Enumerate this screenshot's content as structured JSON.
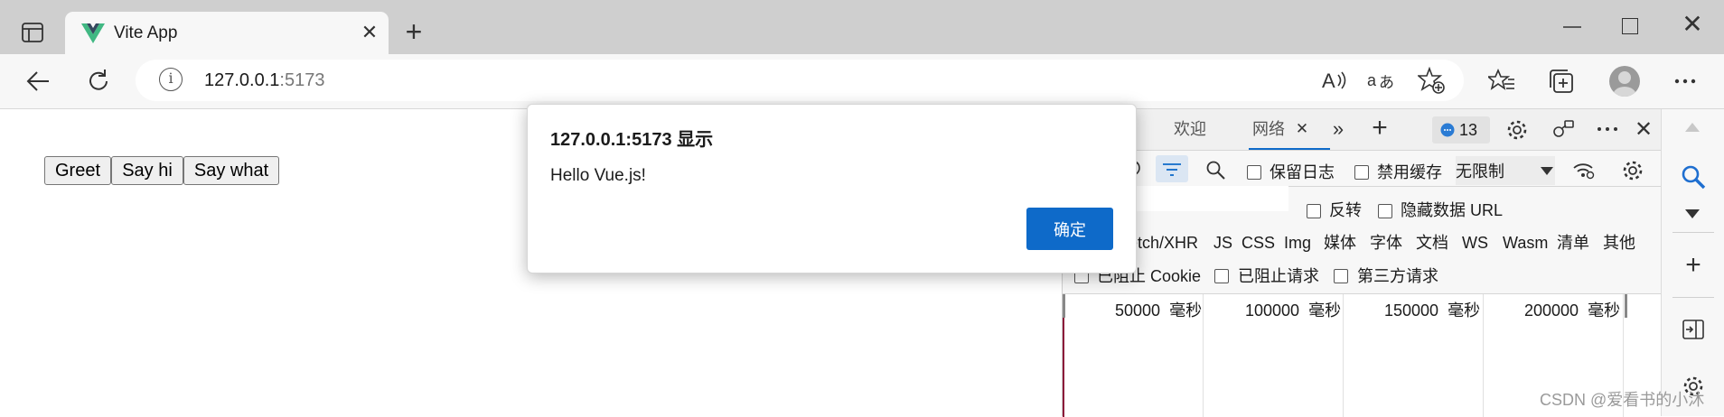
{
  "browser": {
    "tab": {
      "title": "Vite App",
      "favicon": "vue-logo-icon"
    },
    "address": {
      "host": "127.0.0.1",
      "port": ":5173"
    }
  },
  "page": {
    "buttons": [
      "Greet",
      "Say hi",
      "Say what"
    ]
  },
  "dialog": {
    "title": "127.0.0.1:5173 显示",
    "message": "Hello Vue.js!",
    "ok_label": "确定"
  },
  "devtools": {
    "tabs": {
      "welcome": "欢迎",
      "network": "网络"
    },
    "badge_count": "13",
    "toolbar": {
      "preserve_log": "保留日志",
      "disable_cache": "禁用缓存",
      "throttling": "无限制"
    },
    "filter": {
      "invert": "反转",
      "hide_data_urls": "隐藏数据 URL"
    },
    "types": [
      "etch/XHR",
      "JS",
      "CSS",
      "Img",
      "媒体",
      "字体",
      "文档",
      "WS",
      "Wasm",
      "清单",
      "其他"
    ],
    "blocked": {
      "blocked_cookies": "已阻止 Cookie",
      "blocked_requests": "已阻止请求",
      "third_party": "第三方请求"
    },
    "timeline": [
      "50000",
      "100000",
      "150000",
      "200000"
    ],
    "timeline_unit": "毫秒"
  },
  "watermark": "CSDN @爱看书的小沐",
  "colors": {
    "accent": "#0e6ac9",
    "vue_green": "#41b883",
    "vue_dark": "#35495e"
  }
}
